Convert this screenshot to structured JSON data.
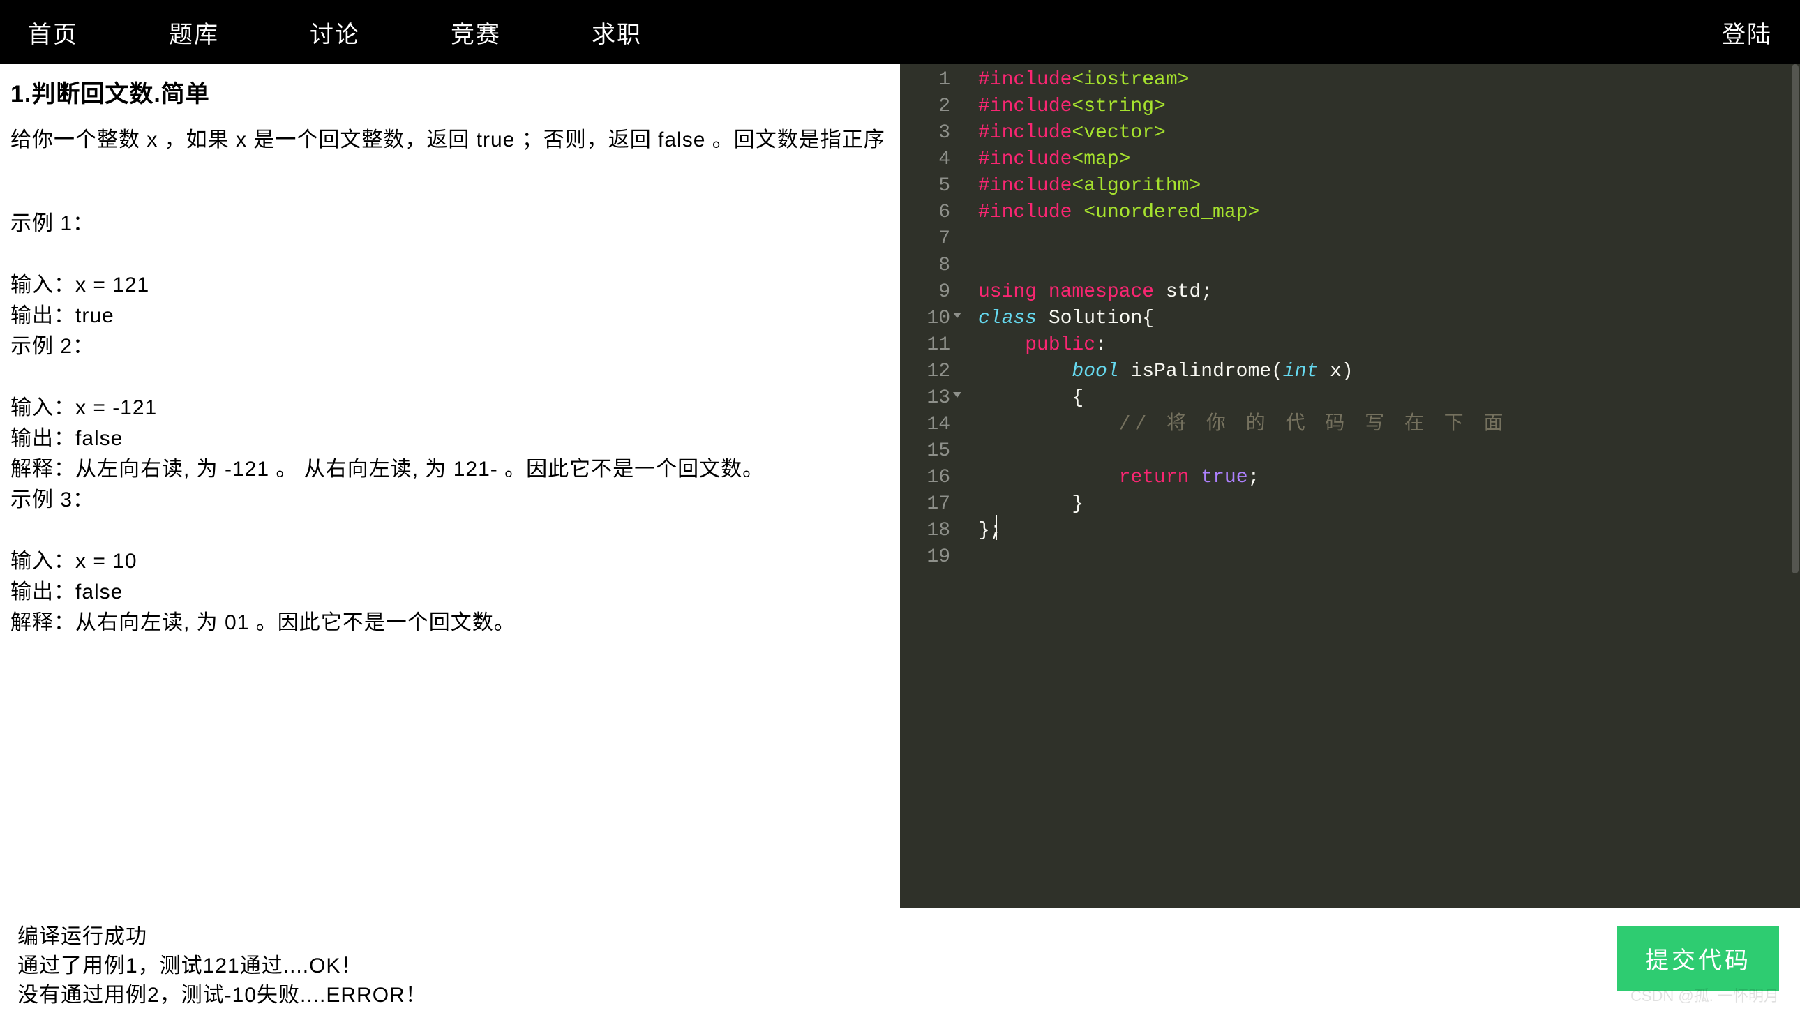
{
  "nav": {
    "items": [
      "首页",
      "题库",
      "讨论",
      "竞赛",
      "求职"
    ],
    "login": "登陆"
  },
  "problem": {
    "title": "1.判断回文数.简单",
    "description": "给你一个整数 x ，如果 x 是一个回文整数，返回 true ；否则，返回 false 。回文数是指正序",
    "example1_label": "示例 1：",
    "ex1_input": "输入：x = 121",
    "ex1_output": "输出：true",
    "example2_label": "示例 2：",
    "ex2_input": "输入：x = -121",
    "ex2_output": "输出：false",
    "ex2_explain": "解释：从左向右读, 为 -121 。 从右向左读, 为 121- 。因此它不是一个回文数。",
    "example3_label": "示例 3：",
    "ex3_input": "输入：x = 10",
    "ex3_output": "输出：false",
    "ex3_explain": "解释：从右向左读, 为 01 。因此它不是一个回文数。"
  },
  "editor": {
    "gutter": [
      "1",
      "2",
      "3",
      "4",
      "5",
      "6",
      "7",
      "8",
      "9",
      "10",
      "11",
      "12",
      "13",
      "14",
      "15",
      "16",
      "17",
      "18",
      "19"
    ],
    "fold_lines": [
      10,
      13
    ],
    "code": {
      "include": "#include",
      "headers": [
        "<iostream>",
        "<string>",
        "<vector>",
        "<map>",
        "<algorithm>",
        " <unordered_map>"
      ],
      "using": "using",
      "namespace": "namespace",
      "std_semicolon": " std;",
      "class": "class",
      "solution": " Solution{",
      "public": "public",
      "colon": ":",
      "bool": "bool",
      "func": " isPalindrome(",
      "int": "int",
      "param": " x)",
      "lbrace": "{",
      "comment": "// 将 你 的 代 码 写 在 下 面",
      "return": "return",
      "true": "true",
      "semicolon": ";",
      "rbrace": "}",
      "end": "};"
    }
  },
  "status": {
    "line1": "编译运行成功",
    "line2": "通过了用例1，测试121通过....OK！",
    "line3": "没有通过用例2，测试-10失败....ERROR！"
  },
  "submit_label": "提交代码",
  "watermark": "CSDN @孤. 一怀明月"
}
